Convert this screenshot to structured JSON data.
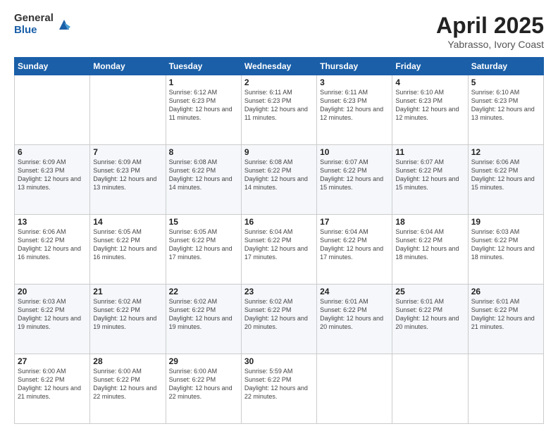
{
  "logo": {
    "general": "General",
    "blue": "Blue"
  },
  "header": {
    "title": "April 2025",
    "subtitle": "Yabrasso, Ivory Coast"
  },
  "weekdays": [
    "Sunday",
    "Monday",
    "Tuesday",
    "Wednesday",
    "Thursday",
    "Friday",
    "Saturday"
  ],
  "weeks": [
    [
      {
        "day": "",
        "empty": true
      },
      {
        "day": "",
        "empty": true
      },
      {
        "day": "1",
        "sunrise": "6:12 AM",
        "sunset": "6:23 PM",
        "daylight": "12 hours and 11 minutes."
      },
      {
        "day": "2",
        "sunrise": "6:11 AM",
        "sunset": "6:23 PM",
        "daylight": "12 hours and 11 minutes."
      },
      {
        "day": "3",
        "sunrise": "6:11 AM",
        "sunset": "6:23 PM",
        "daylight": "12 hours and 12 minutes."
      },
      {
        "day": "4",
        "sunrise": "6:10 AM",
        "sunset": "6:23 PM",
        "daylight": "12 hours and 12 minutes."
      },
      {
        "day": "5",
        "sunrise": "6:10 AM",
        "sunset": "6:23 PM",
        "daylight": "12 hours and 13 minutes."
      }
    ],
    [
      {
        "day": "6",
        "sunrise": "6:09 AM",
        "sunset": "6:23 PM",
        "daylight": "12 hours and 13 minutes."
      },
      {
        "day": "7",
        "sunrise": "6:09 AM",
        "sunset": "6:23 PM",
        "daylight": "12 hours and 13 minutes."
      },
      {
        "day": "8",
        "sunrise": "6:08 AM",
        "sunset": "6:22 PM",
        "daylight": "12 hours and 14 minutes."
      },
      {
        "day": "9",
        "sunrise": "6:08 AM",
        "sunset": "6:22 PM",
        "daylight": "12 hours and 14 minutes."
      },
      {
        "day": "10",
        "sunrise": "6:07 AM",
        "sunset": "6:22 PM",
        "daylight": "12 hours and 15 minutes."
      },
      {
        "day": "11",
        "sunrise": "6:07 AM",
        "sunset": "6:22 PM",
        "daylight": "12 hours and 15 minutes."
      },
      {
        "day": "12",
        "sunrise": "6:06 AM",
        "sunset": "6:22 PM",
        "daylight": "12 hours and 15 minutes."
      }
    ],
    [
      {
        "day": "13",
        "sunrise": "6:06 AM",
        "sunset": "6:22 PM",
        "daylight": "12 hours and 16 minutes."
      },
      {
        "day": "14",
        "sunrise": "6:05 AM",
        "sunset": "6:22 PM",
        "daylight": "12 hours and 16 minutes."
      },
      {
        "day": "15",
        "sunrise": "6:05 AM",
        "sunset": "6:22 PM",
        "daylight": "12 hours and 17 minutes."
      },
      {
        "day": "16",
        "sunrise": "6:04 AM",
        "sunset": "6:22 PM",
        "daylight": "12 hours and 17 minutes."
      },
      {
        "day": "17",
        "sunrise": "6:04 AM",
        "sunset": "6:22 PM",
        "daylight": "12 hours and 17 minutes."
      },
      {
        "day": "18",
        "sunrise": "6:04 AM",
        "sunset": "6:22 PM",
        "daylight": "12 hours and 18 minutes."
      },
      {
        "day": "19",
        "sunrise": "6:03 AM",
        "sunset": "6:22 PM",
        "daylight": "12 hours and 18 minutes."
      }
    ],
    [
      {
        "day": "20",
        "sunrise": "6:03 AM",
        "sunset": "6:22 PM",
        "daylight": "12 hours and 19 minutes."
      },
      {
        "day": "21",
        "sunrise": "6:02 AM",
        "sunset": "6:22 PM",
        "daylight": "12 hours and 19 minutes."
      },
      {
        "day": "22",
        "sunrise": "6:02 AM",
        "sunset": "6:22 PM",
        "daylight": "12 hours and 19 minutes."
      },
      {
        "day": "23",
        "sunrise": "6:02 AM",
        "sunset": "6:22 PM",
        "daylight": "12 hours and 20 minutes."
      },
      {
        "day": "24",
        "sunrise": "6:01 AM",
        "sunset": "6:22 PM",
        "daylight": "12 hours and 20 minutes."
      },
      {
        "day": "25",
        "sunrise": "6:01 AM",
        "sunset": "6:22 PM",
        "daylight": "12 hours and 20 minutes."
      },
      {
        "day": "26",
        "sunrise": "6:01 AM",
        "sunset": "6:22 PM",
        "daylight": "12 hours and 21 minutes."
      }
    ],
    [
      {
        "day": "27",
        "sunrise": "6:00 AM",
        "sunset": "6:22 PM",
        "daylight": "12 hours and 21 minutes."
      },
      {
        "day": "28",
        "sunrise": "6:00 AM",
        "sunset": "6:22 PM",
        "daylight": "12 hours and 22 minutes."
      },
      {
        "day": "29",
        "sunrise": "6:00 AM",
        "sunset": "6:22 PM",
        "daylight": "12 hours and 22 minutes."
      },
      {
        "day": "30",
        "sunrise": "5:59 AM",
        "sunset": "6:22 PM",
        "daylight": "12 hours and 22 minutes."
      },
      {
        "day": "",
        "empty": true
      },
      {
        "day": "",
        "empty": true
      },
      {
        "day": "",
        "empty": true
      }
    ]
  ]
}
